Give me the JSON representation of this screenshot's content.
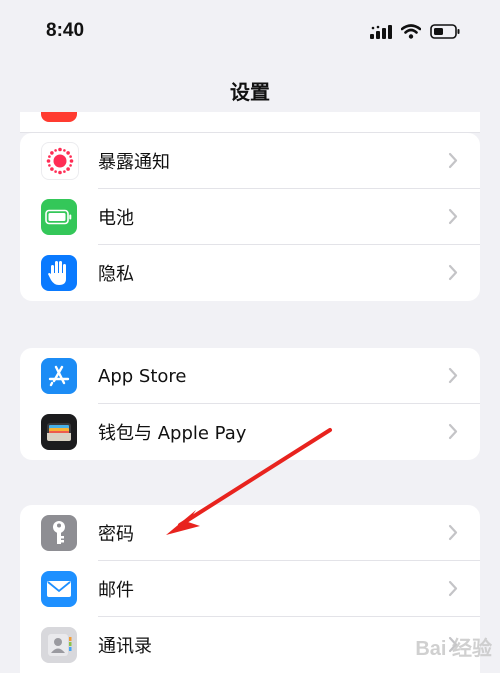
{
  "status_bar": {
    "time": "8:40"
  },
  "nav": {
    "title": "设置"
  },
  "group1": {
    "items": [
      {
        "label": "暴露通知",
        "icon": "exposure-notification-icon"
      },
      {
        "label": "电池",
        "icon": "battery-icon"
      },
      {
        "label": "隐私",
        "icon": "privacy-hand-icon"
      }
    ]
  },
  "group2": {
    "items": [
      {
        "label": "App Store",
        "icon": "app-store-icon"
      },
      {
        "label": "钱包与 Apple Pay",
        "icon": "wallet-icon"
      }
    ]
  },
  "group3": {
    "items": [
      {
        "label": "密码",
        "icon": "key-icon"
      },
      {
        "label": "邮件",
        "icon": "mail-icon"
      },
      {
        "label": "通讯录",
        "icon": "contacts-icon"
      }
    ]
  },
  "watermark": {
    "text": "Bai 经验"
  },
  "colors": {
    "background": "#f1f1f5",
    "exposure": "#ff2d55",
    "battery": "#34c759",
    "privacy": "#0a7aff",
    "appstore": "#1c8cf5",
    "wallet": "#1c1c1e",
    "passwords": "#8e8e93",
    "mail": "#1e90ff",
    "contacts": "#d8d8dc",
    "annotation_arrow": "#e8231e"
  }
}
